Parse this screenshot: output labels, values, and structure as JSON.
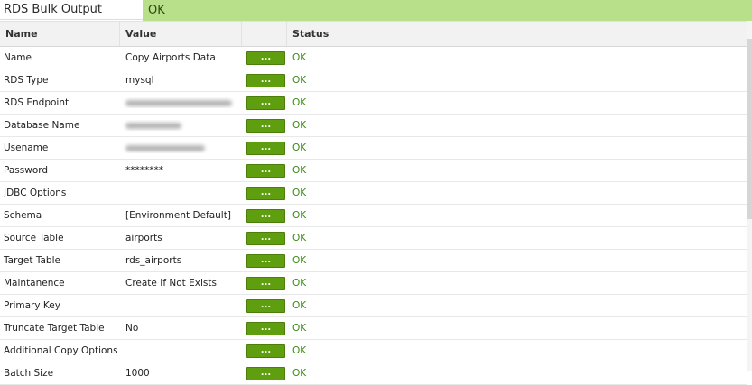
{
  "header": {
    "title": "RDS Bulk Output",
    "status": "OK"
  },
  "columns": {
    "name": "Name",
    "value": "Value",
    "button": "",
    "status": "Status"
  },
  "button_label": "...",
  "rows": [
    {
      "name": "Name",
      "value": "Copy Airports Data",
      "status": "OK"
    },
    {
      "name": "RDS Type",
      "value": "mysql",
      "status": "OK"
    },
    {
      "name": "RDS Endpoint",
      "value": "",
      "status": "OK"
    },
    {
      "name": "Database Name",
      "value": "",
      "status": "OK"
    },
    {
      "name": "Usename",
      "value": "",
      "status": "OK"
    },
    {
      "name": "Password",
      "value": "********",
      "status": "OK"
    },
    {
      "name": "JDBC Options",
      "value": "",
      "status": "OK"
    },
    {
      "name": "Schema",
      "value": "[Environment Default]",
      "status": "OK"
    },
    {
      "name": "Source Table",
      "value": "airports",
      "status": "OK"
    },
    {
      "name": "Target Table",
      "value": "rds_airports",
      "status": "OK"
    },
    {
      "name": "Maintanence",
      "value": "Create If Not Exists",
      "status": "OK"
    },
    {
      "name": "Primary Key",
      "value": "",
      "status": "OK"
    },
    {
      "name": "Truncate Target Table",
      "value": "No",
      "status": "OK"
    },
    {
      "name": "Additional Copy Options",
      "value": "",
      "status": "OK"
    },
    {
      "name": "Batch Size",
      "value": "1000",
      "status": "OK"
    }
  ]
}
